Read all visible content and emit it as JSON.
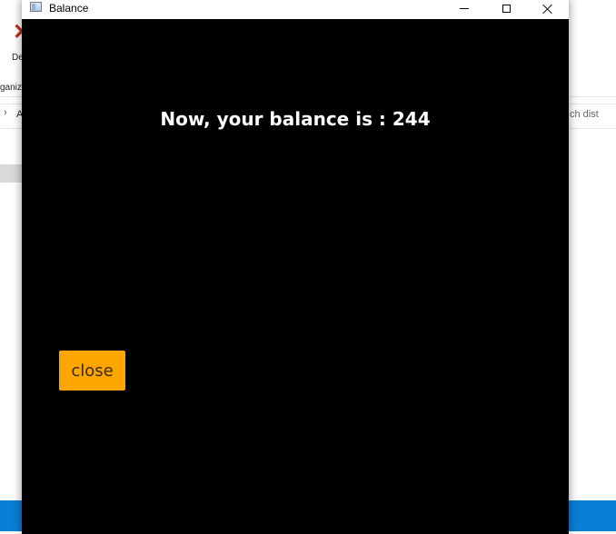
{
  "background_window": {
    "ribbon_delete_label": "De",
    "ribbon_group_label": "ganiz",
    "address_chevron": "›",
    "address_text": "A",
    "search_placeholder": "ch dist"
  },
  "window": {
    "title": "Balance",
    "controls": {
      "minimize_icon": "minimize-icon",
      "maximize_icon": "maximize-icon",
      "close_icon": "close-icon"
    }
  },
  "main": {
    "balance_message": "Now, your balance is : 244",
    "close_button_label": "close"
  },
  "colors": {
    "content_background": "#000000",
    "button_background": "#ffa500",
    "text": "#ffffff"
  }
}
